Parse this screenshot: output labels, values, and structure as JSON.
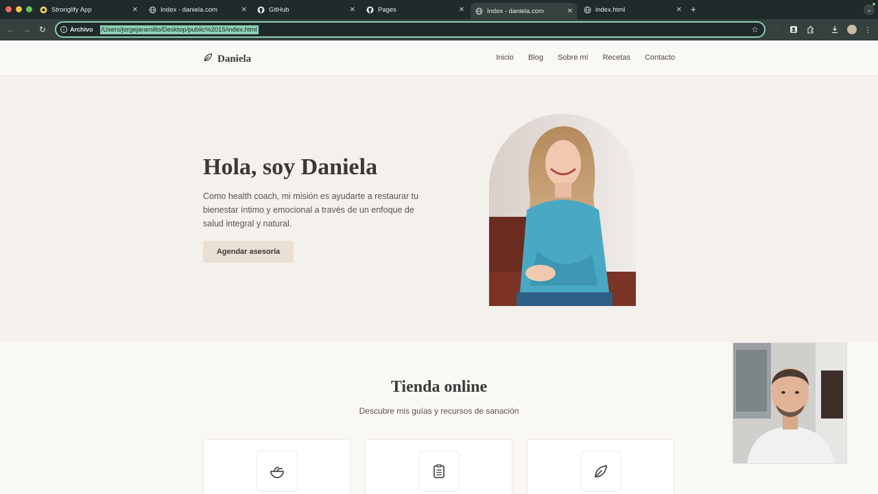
{
  "browser": {
    "tabs": [
      {
        "label": "Stronglify App",
        "icon": "stronglify-icon"
      },
      {
        "label": "Index - daniela.com",
        "icon": "globe-icon"
      },
      {
        "label": "GitHub",
        "icon": "github-icon"
      },
      {
        "label": "Pages",
        "icon": "github-icon"
      },
      {
        "label": "Index - daniela.com",
        "icon": "globe-icon",
        "active": true
      },
      {
        "label": "index.html",
        "icon": "globe-icon"
      }
    ],
    "address": {
      "chip": "Archivo",
      "url": "/Users/jorgejaramillo/Desktop/public%2015/index.html"
    }
  },
  "site": {
    "brand": "Daniela",
    "nav": [
      "Inicio",
      "Blog",
      "Sobre mí",
      "Recetas",
      "Contacto"
    ],
    "hero": {
      "title": "Hola, soy Daniela",
      "text": "Como health coach, mi misión es ayudarte a restaurar tu bienestar íntimo y emocional a través de un enfoque de salud integral y natural.",
      "cta": "Agendar asesoría"
    },
    "shop": {
      "title": "Tienda online",
      "subtitle": "Descubre mis guías y recursos de sanación",
      "cards": [
        {
          "icon": "salad-bowl-icon"
        },
        {
          "icon": "clipboard-icon"
        },
        {
          "icon": "leaf-icon"
        }
      ]
    }
  },
  "colors": {
    "chrome_dark": "#1f2a2a",
    "chrome_toolbar": "#35413f",
    "omnibox_focus": "#8fd0b4",
    "hero_bg": "#f4f0eb",
    "cta_bg": "#e9dfd5",
    "text_dark": "#3b3935"
  }
}
